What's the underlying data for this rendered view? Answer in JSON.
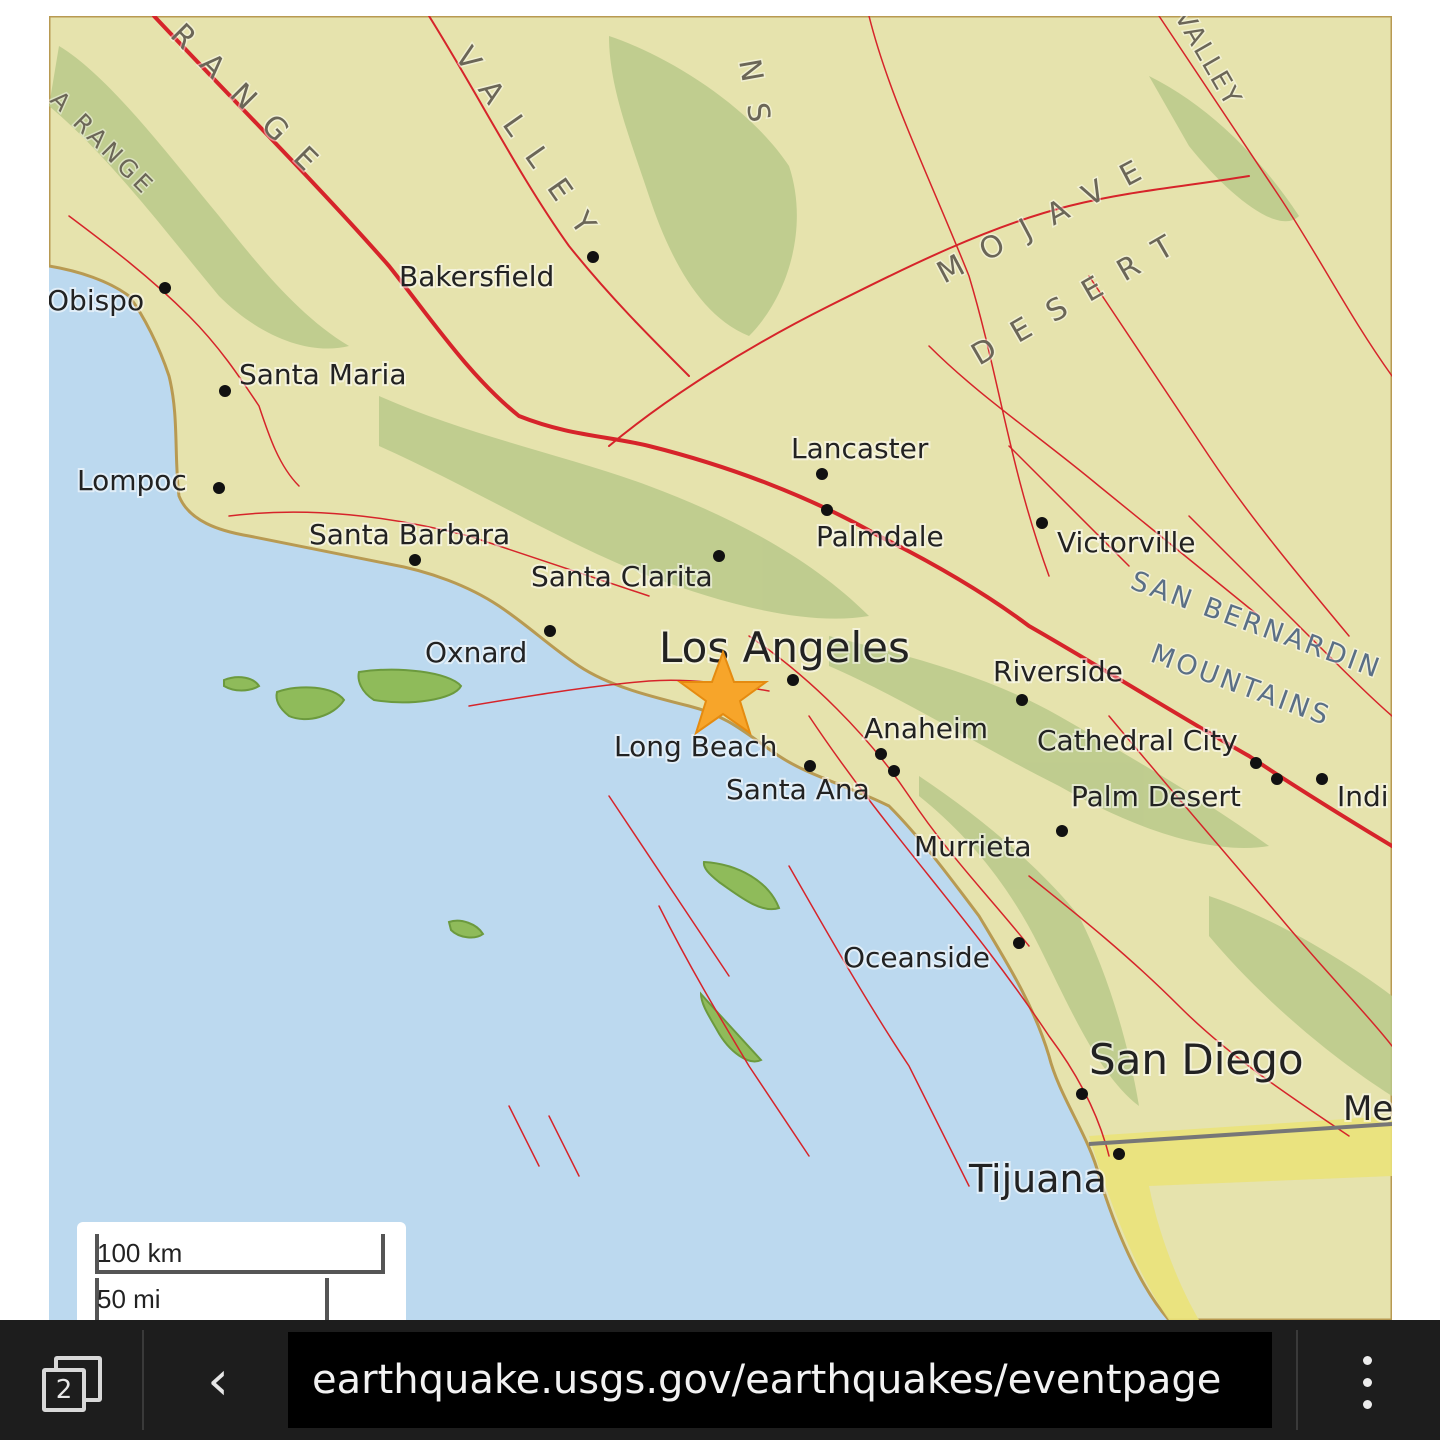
{
  "map": {
    "cities": {
      "bakersfield": "Bakersfield",
      "obispo": "Obispo",
      "santa_maria": "Santa Maria",
      "lompoc": "Lompoc",
      "santa_barbara": "Santa Barbara",
      "santa_clarita": "Santa Clarita",
      "oxnard": "Oxnard",
      "los_angeles": "Los Angeles",
      "long_beach": "Long Beach",
      "santa_ana": "Santa Ana",
      "anaheim": "Anaheim",
      "lancaster": "Lancaster",
      "palmdale": "Palmdale",
      "victorville": "Victorville",
      "riverside": "Riverside",
      "cathedral_city": "Cathedral City",
      "palm_desert": "Palm Desert",
      "indio": "Indi",
      "murrieta": "Murrieta",
      "oceanside": "Oceanside",
      "san_diego": "San Diego",
      "tijuana": "Tijuana",
      "mexico": "Me"
    },
    "regions": {
      "range_top": "RANGE",
      "range_left": "A RANGE",
      "valley": "VALLEY",
      "mountains_fragment": "NS",
      "valley_right": "VALLEY",
      "mojave": "MOJAVE",
      "desert": "DESERT",
      "san_bernardino": "SAN BERNARDIN",
      "mountains": "MOUNTAINS"
    },
    "epicenter_icon": "star-icon"
  },
  "scale_bar": {
    "km_label": "100 km",
    "mi_label": "50 mi"
  },
  "browser": {
    "tab_count": "2",
    "url": "earthquake.usgs.gov/earthquakes/eventpage",
    "back_icon": "chevron-left-icon",
    "menu_icon": "more-vertical-icon",
    "colors": {
      "bar": "#1d1d1d",
      "url_field": "#000000",
      "fault": "#d6242a",
      "epicenter": "#f5a623"
    }
  }
}
